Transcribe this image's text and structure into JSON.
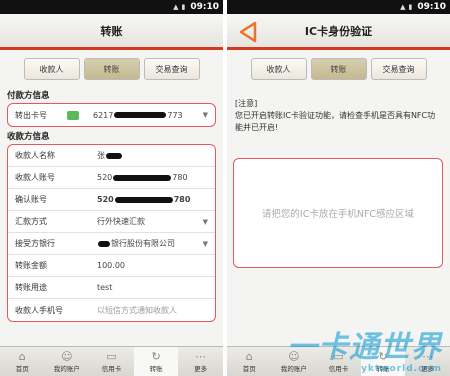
{
  "status": {
    "time": "09:10"
  },
  "tabs": [
    "收款人",
    "转账",
    "交易查询"
  ],
  "left": {
    "title": "转账",
    "payer_section": "付款方信息",
    "payer": {
      "label": "转出卡号",
      "prefix": "6217",
      "suffix": "773"
    },
    "payee_section": "收款方信息",
    "fields": [
      {
        "label": "收款人名称",
        "prefix": "张",
        "suffix": ""
      },
      {
        "label": "收款人账号",
        "prefix": "520",
        "suffix": "780"
      },
      {
        "label": "确认账号",
        "prefix": "520",
        "suffix": "780"
      },
      {
        "label": "汇款方式",
        "value": "行外快速汇款"
      },
      {
        "label": "接受方银行",
        "value": "银行股份有限公司"
      },
      {
        "label": "转账金额",
        "value": "100.00"
      },
      {
        "label": "转账用途",
        "value": "test"
      },
      {
        "label": "收款人手机号",
        "hint": "以短信方式通知收款人"
      }
    ]
  },
  "right": {
    "title": "IC卡身份验证",
    "notice_head": "[注意]",
    "notice_body": "您已开启转账IC卡验证功能，请检查手机是否具有NFC功能并已开启!",
    "nfc_prompt": "请把您的IC卡放在手机NFC感应区域"
  },
  "nav": [
    "首页",
    "我的账户",
    "信用卡",
    "转账",
    "更多"
  ],
  "nav_icons": [
    "home-icon",
    "user-icon",
    "credit-card-icon",
    "transfer-icon",
    "more-icon"
  ],
  "watermark": {
    "text": "一卡通世界",
    "url": "yktworld.com"
  },
  "colors": {
    "accent": "#d33a22",
    "border": "#e45a5a",
    "card": "#5cb85c"
  }
}
